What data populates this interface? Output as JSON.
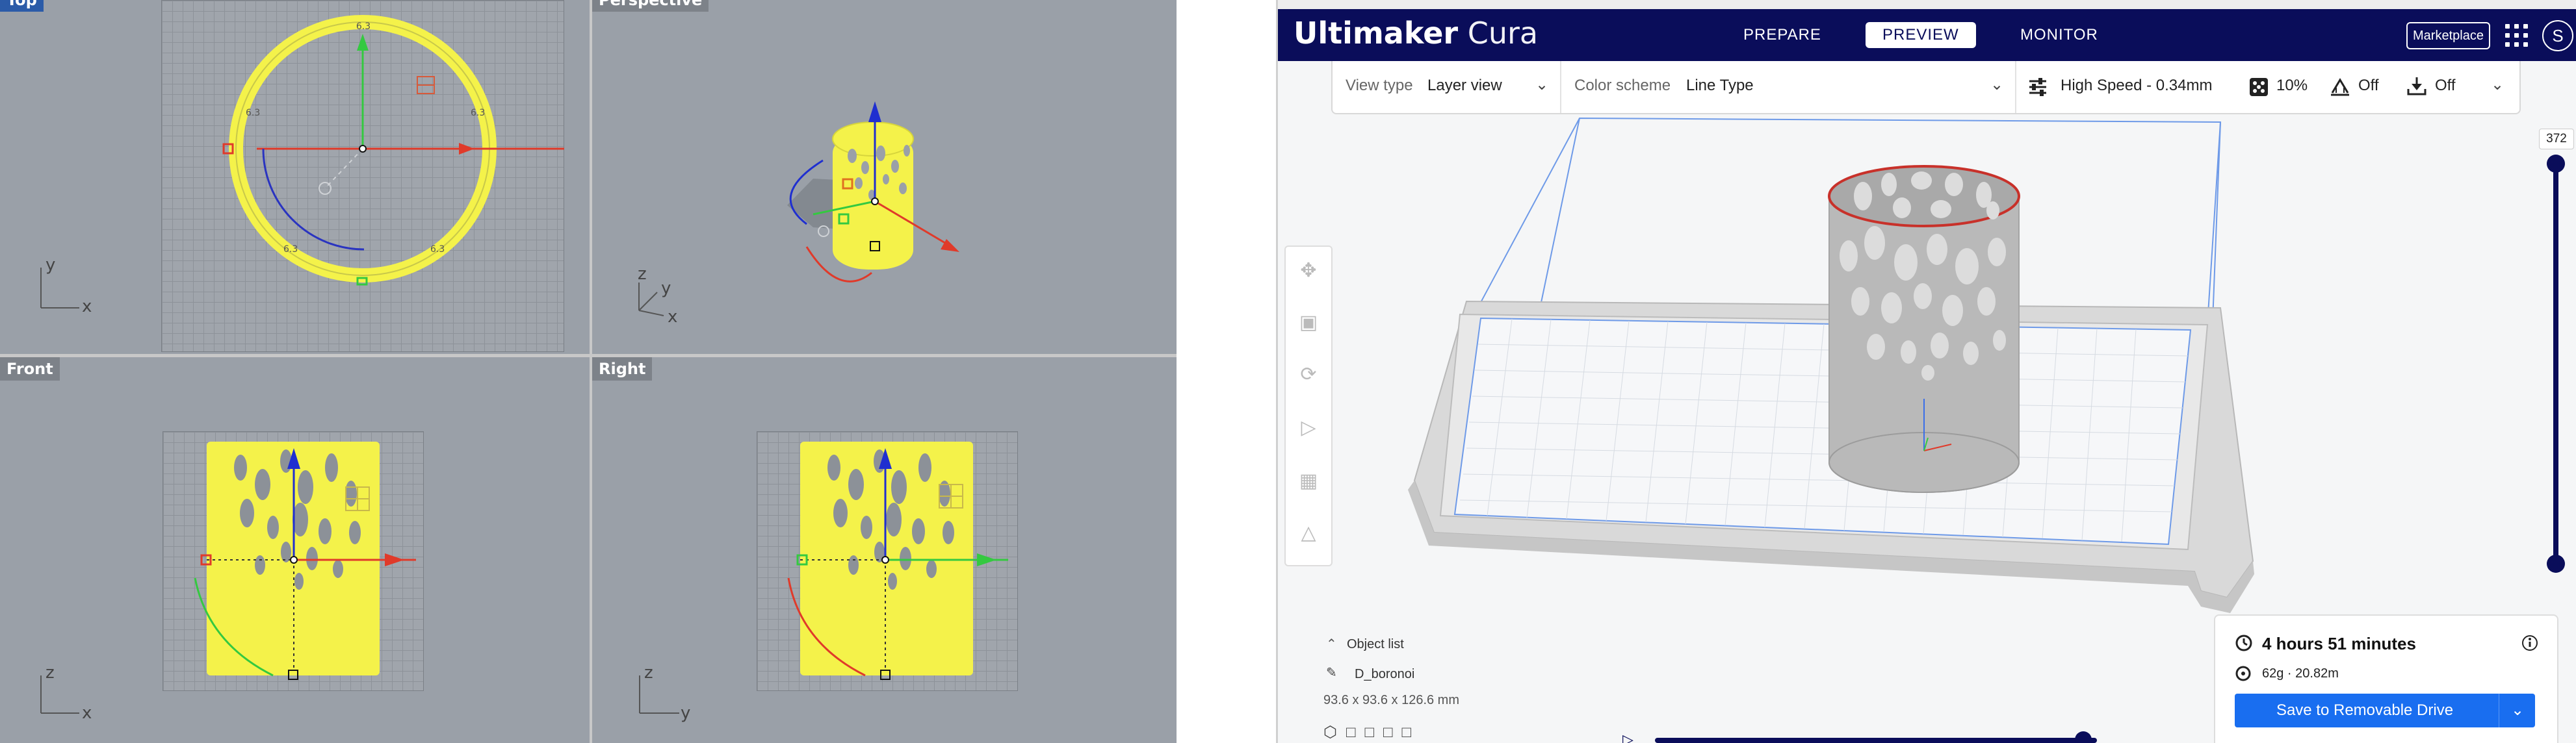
{
  "rhino": {
    "viewports": [
      {
        "label": "Top",
        "axes": [
          "y",
          "x"
        ]
      },
      {
        "label": "Perspective",
        "axes": [
          "z",
          "y",
          "x"
        ]
      },
      {
        "label": "Front",
        "axes": [
          "z",
          "x"
        ]
      },
      {
        "label": "Right",
        "axes": [
          "z",
          "y"
        ]
      }
    ],
    "ring_labels": [
      "6.3",
      "6.3",
      "6.3",
      "6.3",
      "6.3"
    ]
  },
  "cura": {
    "brand_bold": "Ultimaker",
    "brand_rest": " Cura",
    "stages": [
      "PREPARE",
      "PREVIEW",
      "MONITOR"
    ],
    "selected_stage": "PREVIEW",
    "marketplace": "Marketplace",
    "avatar_initial": "S",
    "toolbar": {
      "view_type_label": "View type",
      "view_type_value": "Layer view",
      "color_scheme_label": "Color scheme",
      "color_scheme_value": "Line Type",
      "profile": "High Speed - 0.34mm",
      "infill": "10%",
      "support": "Off",
      "adhesion": "Off"
    },
    "layer_slider": {
      "current_layer": "372"
    },
    "object_list": {
      "header": "Object list",
      "object_name": "D_boronoi",
      "dimensions": "93.6 x 93.6 x 126.6 mm"
    },
    "print_info": {
      "time": "4 hours 51 minutes",
      "material": "62g · 20.82m",
      "save_button": "Save to Removable Drive"
    },
    "colors": {
      "header_bg": "#0a0d5a",
      "accent": "#196ef0",
      "model_yellow": "#f4f24a"
    }
  }
}
